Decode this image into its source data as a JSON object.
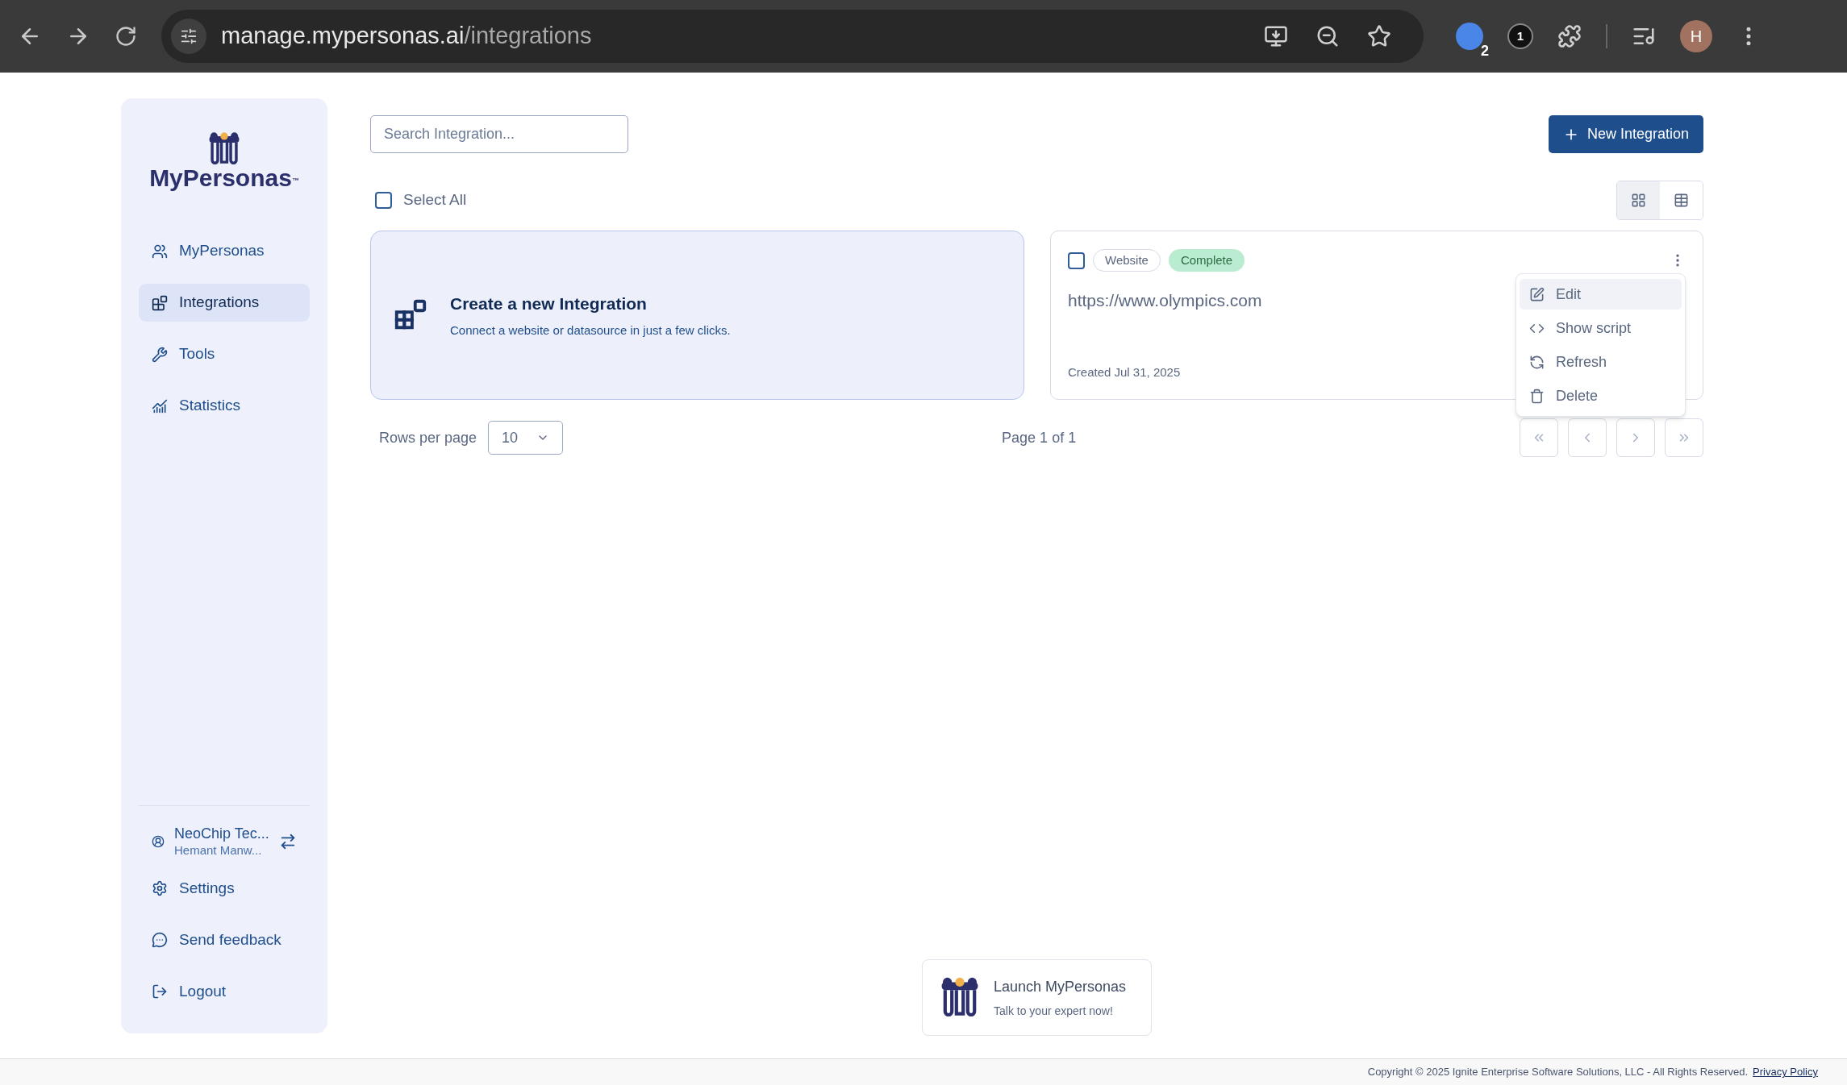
{
  "browser": {
    "url_host": "manage.mypersonas.ai",
    "url_path": "/integrations",
    "extension_badge": "2",
    "extension_count": "1",
    "profile_initial": "H"
  },
  "sidebar": {
    "logo_text": "MyPersonas",
    "logo_mark": "™",
    "nav": [
      {
        "label": "MyPersonas",
        "selected": false
      },
      {
        "label": "Integrations",
        "selected": true
      },
      {
        "label": "Tools",
        "selected": false
      },
      {
        "label": "Statistics",
        "selected": false
      }
    ],
    "account": {
      "org": "NeoChip Tec...",
      "user": "Hemant Manw..."
    },
    "bottom": [
      {
        "label": "Settings"
      },
      {
        "label": "Send feedback"
      },
      {
        "label": "Logout"
      }
    ]
  },
  "toolbar": {
    "search_placeholder": "Search Integration...",
    "new_button": "New Integration",
    "select_all": {
      "label": "Select All",
      "checked": false
    },
    "view_toggle": [
      {
        "kind": "grid",
        "selected": true
      },
      {
        "kind": "table",
        "selected": false
      }
    ]
  },
  "create_card": {
    "title": "Create a new Integration",
    "subtitle": "Connect a website or datasource in just a few clicks."
  },
  "integrations": [
    {
      "checked": false,
      "type": "Website",
      "status": "Complete",
      "url": "https://www.olympics.com",
      "created": "Created Jul 31, 2025"
    }
  ],
  "context_menu": [
    {
      "label": "Edit",
      "highlighted": true
    },
    {
      "label": "Show script",
      "highlighted": false
    },
    {
      "label": "Refresh",
      "highlighted": false
    },
    {
      "label": "Delete",
      "highlighted": false
    }
  ],
  "pagination": {
    "rows_label": "Rows per page",
    "rows_value": "10",
    "page_text": "Page 1 of 1"
  },
  "launch": {
    "title": "Launch MyPersonas",
    "subtitle": "Talk to your expert now!"
  },
  "footer": {
    "copyright": "Copyright © 2025 Ignite Enterprise Software Solutions, LLC - All Rights Reserved.",
    "link": "Privacy Policy"
  }
}
